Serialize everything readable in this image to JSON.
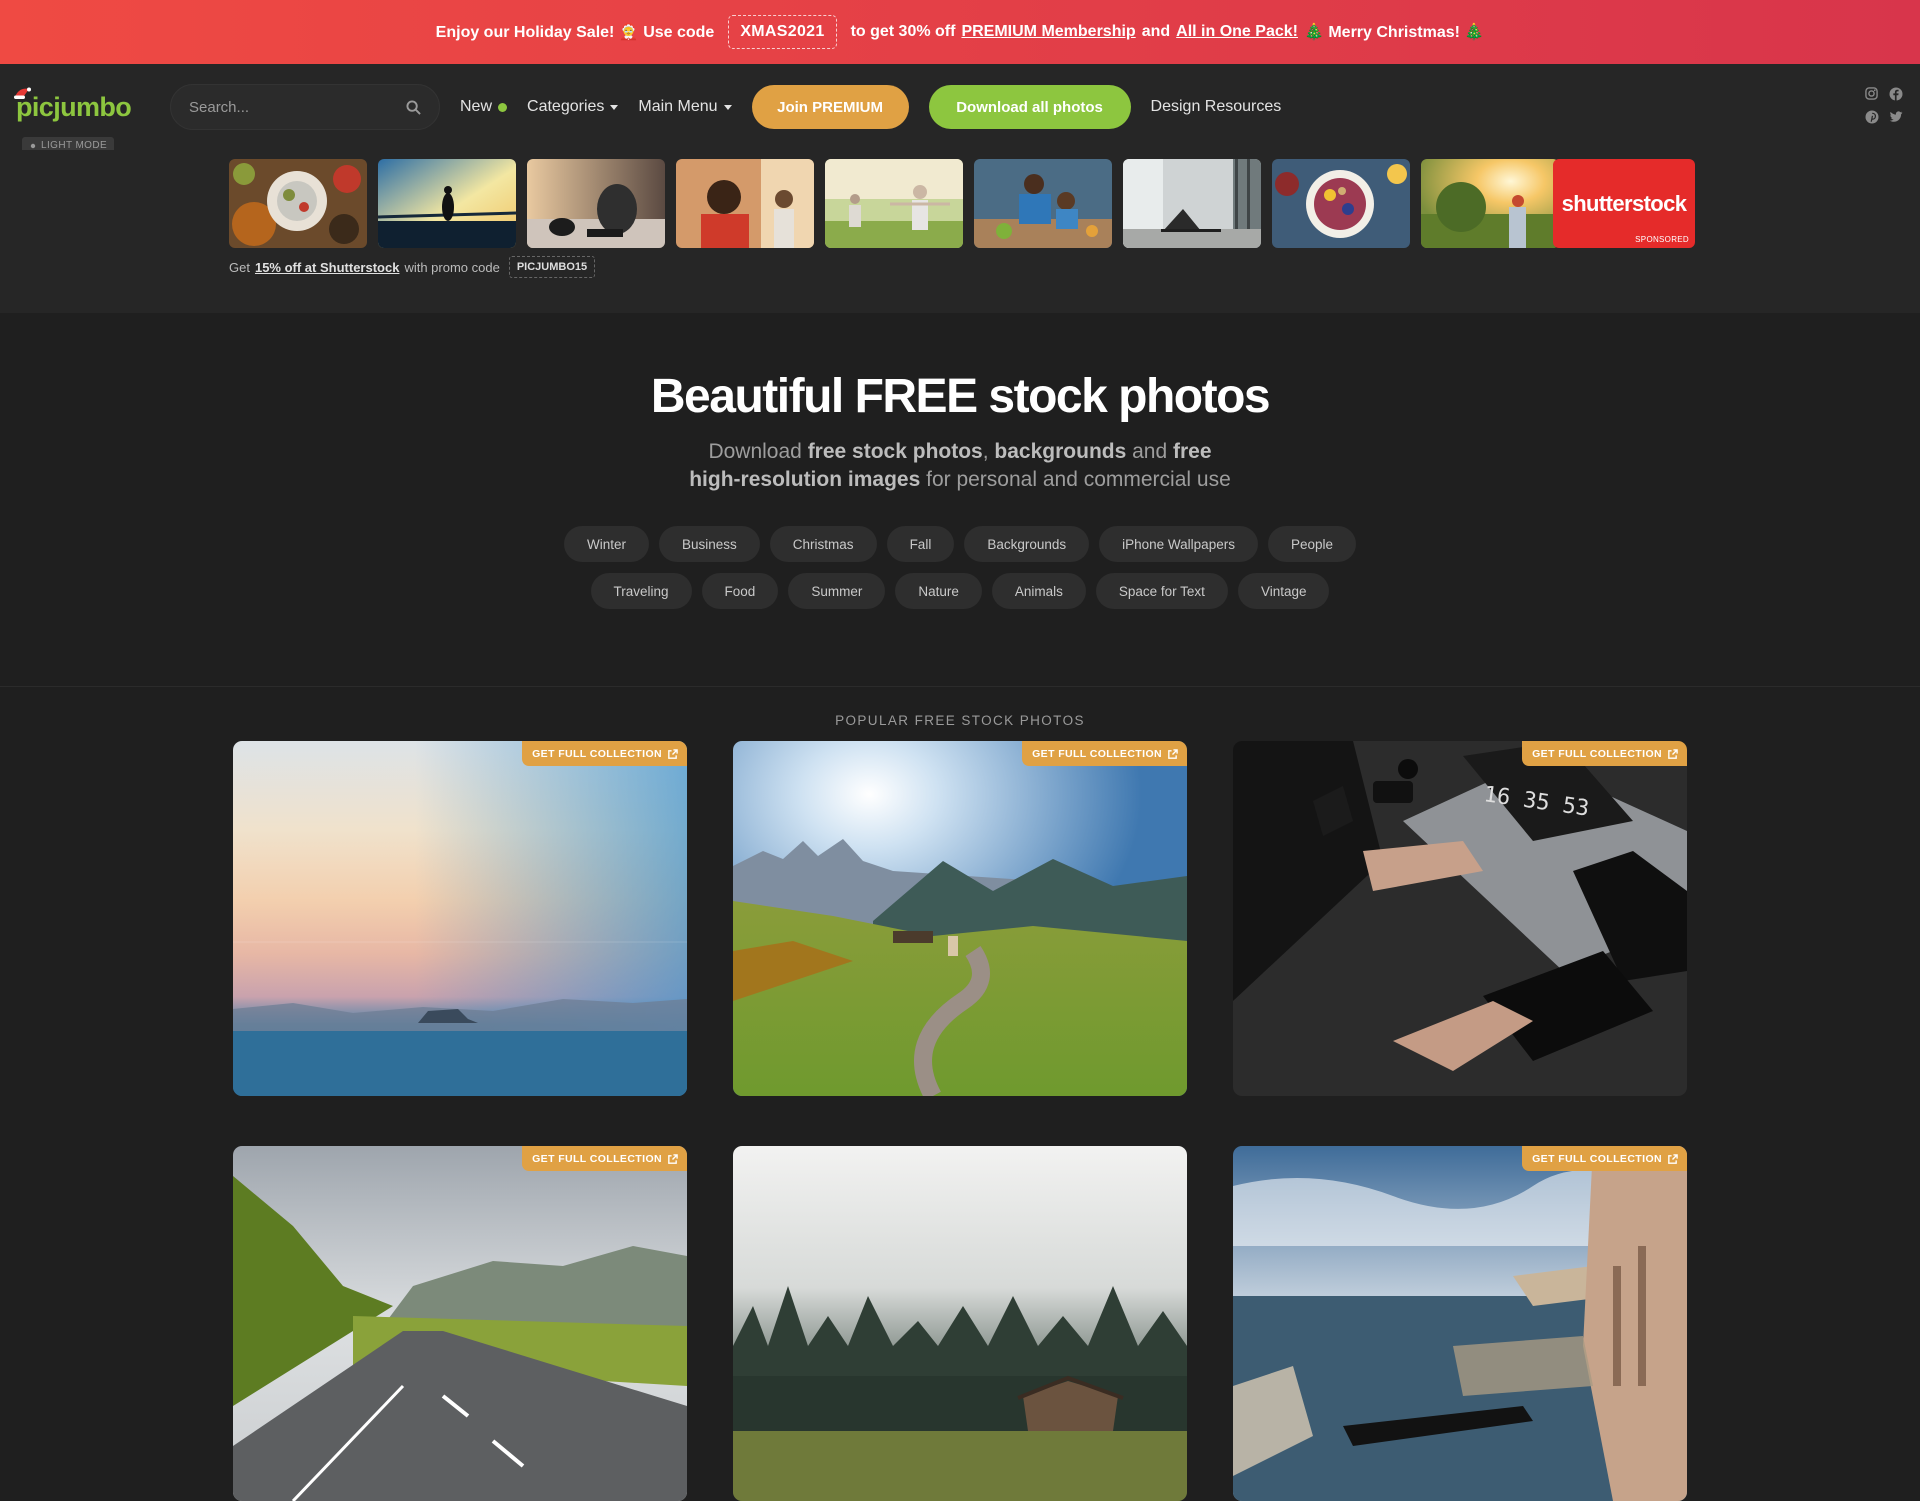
{
  "promo": {
    "text_before": "Enjoy our Holiday Sale! 🤶 Use code",
    "code": "XMAS2021",
    "text_middle": "to get 30% off",
    "link1": "PREMIUM Membership",
    "and": "and",
    "link2": "All in One Pack!",
    "text_end": "🎄 Merry Christmas! 🎄"
  },
  "header": {
    "logo": "picjumbo",
    "light_mode": "LIGHT MODE",
    "search_placeholder": "Search...",
    "nav_new": "New",
    "nav_categories": "Categories",
    "nav_main_menu": "Main Menu",
    "btn_premium": "Join PREMIUM",
    "btn_download": "Download all photos",
    "nav_design": "Design Resources"
  },
  "sponsor": {
    "brand": "shutterstock",
    "sponsored_label": "SPONSORED",
    "line_before": "Get",
    "line_link": "15% off at Shutterstock",
    "line_after": "with promo code",
    "promo_code": "PICJUMBO15"
  },
  "hero": {
    "title": "Beautiful FREE stock photos",
    "sub_1": "Download",
    "sub_b1": "free stock photos",
    "sub_2": ",",
    "sub_b2": "backgrounds",
    "sub_3": "and",
    "sub_b3": "free high-resolution images",
    "sub_4": "for personal and commercial use"
  },
  "tags": [
    "Winter",
    "Business",
    "Christmas",
    "Fall",
    "Backgrounds",
    "iPhone Wallpapers",
    "People",
    "Traveling",
    "Food",
    "Summer",
    "Nature",
    "Animals",
    "Space for Text",
    "Vintage"
  ],
  "section_title": "POPULAR FREE STOCK PHOTOS",
  "badge_label": "GET FULL COLLECTION",
  "colors": {
    "accent_green": "#8dc63f",
    "accent_orange": "#e0a144",
    "promo_red": "#ef4a43",
    "shutterstock_red": "#e52b2a"
  }
}
